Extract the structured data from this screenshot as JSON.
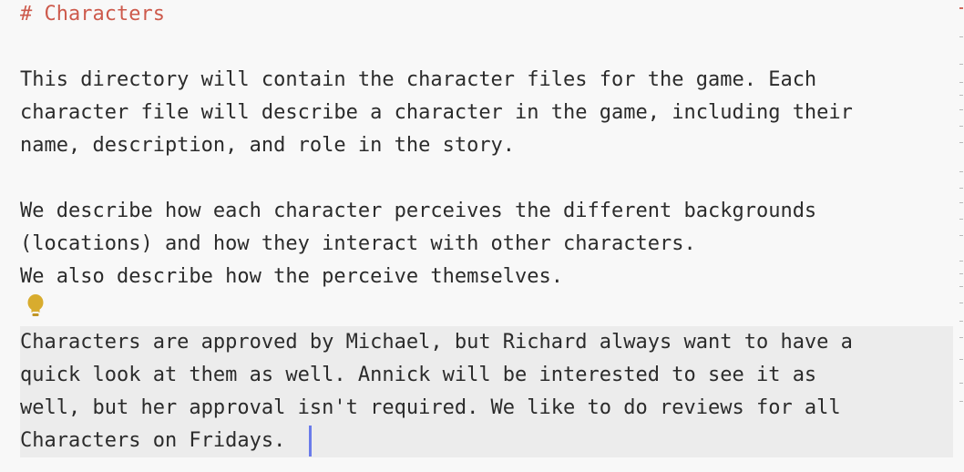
{
  "editor": {
    "heading": "# Characters",
    "paragraph1": [
      "This directory will contain the character files for the game. Each",
      "character file will describe a character in the game, including their",
      "name, description, and role in the story."
    ],
    "paragraph2": [
      "We describe how each character perceives the different backgrounds",
      "(locations) and how they interact with other characters.",
      "We also describe how the perceive themselves."
    ],
    "paragraph3": [
      "Characters are approved by Michael, but Richard always want to have a",
      "quick look at them as well. Annick will be interested to see it as",
      "well, but her approval isn't required. We like to do reviews for all",
      "Characters on Fridays."
    ]
  },
  "colors": {
    "heading": "#cd5a4c",
    "text": "#2b2b2b",
    "background": "#f8f8f8",
    "active_block": "#ececec",
    "caret": "#6a7bea",
    "lightbulb": "#d8ac2e"
  },
  "icons": {
    "hint": "lightbulb-icon"
  }
}
